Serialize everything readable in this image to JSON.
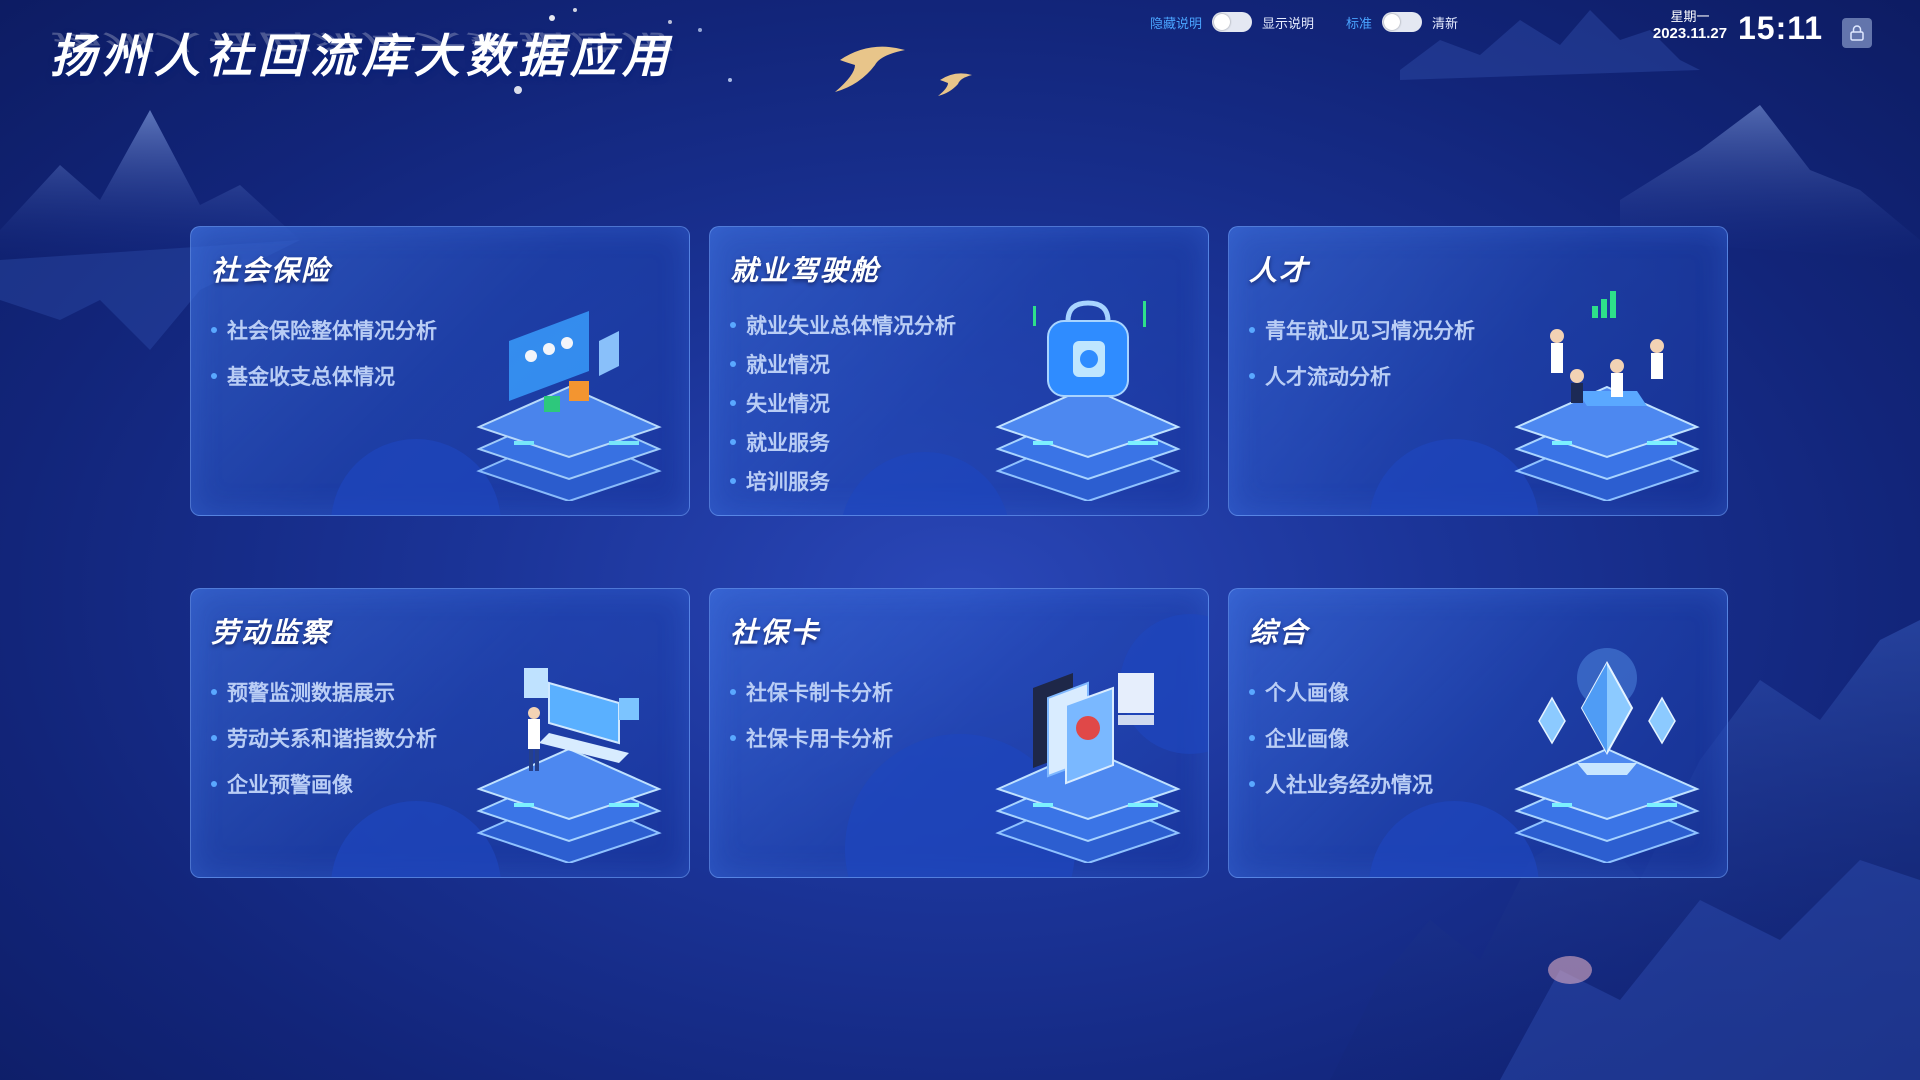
{
  "app": {
    "title": "扬州人社回流库大数据应用"
  },
  "toggles": {
    "explain": {
      "off_label": "隐藏说明",
      "on_label": "显示说明"
    },
    "theme": {
      "off_label": "标准",
      "on_label": "清新"
    }
  },
  "clock": {
    "weekday": "星期一",
    "date": "2023.11.27",
    "time": "15:11"
  },
  "cards": [
    {
      "title": "社会保险",
      "items": [
        "社会保险整体情况分析",
        "基金收支总体情况"
      ]
    },
    {
      "title": "就业驾驶舱",
      "items": [
        "就业失业总体情况分析",
        "就业情况",
        "失业情况",
        "就业服务",
        "培训服务"
      ]
    },
    {
      "title": "人才",
      "items": [
        "青年就业见习情况分析",
        "人才流动分析"
      ]
    },
    {
      "title": "劳动监察",
      "items": [
        "预警监测数据展示",
        "劳动关系和谐指数分析",
        "企业预警画像"
      ]
    },
    {
      "title": "社保卡",
      "items": [
        "社保卡制卡分析",
        "社保卡用卡分析"
      ]
    },
    {
      "title": "综合",
      "items": [
        "个人画像",
        "企业画像",
        "人社业务经办情况"
      ]
    }
  ],
  "colors": {
    "accent": "#4aa4ff",
    "bullet": "#5aa8ff",
    "item_text": "#b9cdf5"
  }
}
